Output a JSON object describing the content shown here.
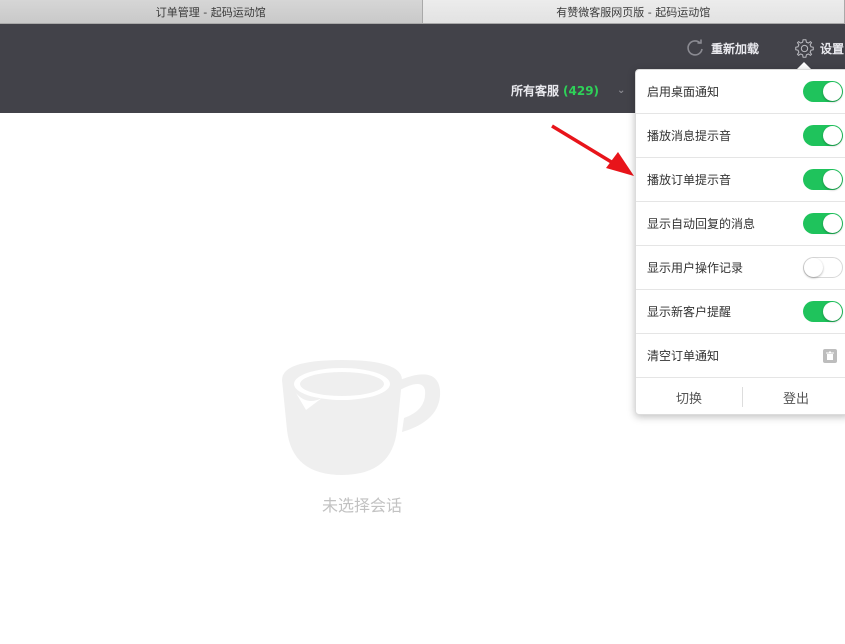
{
  "browser": {
    "tabs": [
      {
        "label": "订单管理 - 起码运动馆",
        "active": false
      },
      {
        "label": "有赞微客服网页版 - 起码运动馆",
        "active": true
      }
    ]
  },
  "header": {
    "reload_label": "重新加载",
    "settings_label": "设置",
    "agents_label": "所有客服",
    "agents_count": "(429)"
  },
  "settings_menu": {
    "items": [
      {
        "label": "启用桌面通知",
        "enabled": true
      },
      {
        "label": "播放消息提示音",
        "enabled": true
      },
      {
        "label": "播放订单提示音",
        "enabled": true
      },
      {
        "label": "显示自动回复的消息",
        "enabled": true
      },
      {
        "label": "显示用户操作记录",
        "enabled": false
      },
      {
        "label": "显示新客户提醒",
        "enabled": true
      }
    ],
    "clear_label": "清空订单通知",
    "switch_label": "切换",
    "logout_label": "登出"
  },
  "empty_state": {
    "text": "未选择会话"
  },
  "colors": {
    "header_bg": "#424249",
    "toggle_on": "#1fc35c",
    "count_green": "#2ed158",
    "arrow_red": "#e8141a"
  }
}
